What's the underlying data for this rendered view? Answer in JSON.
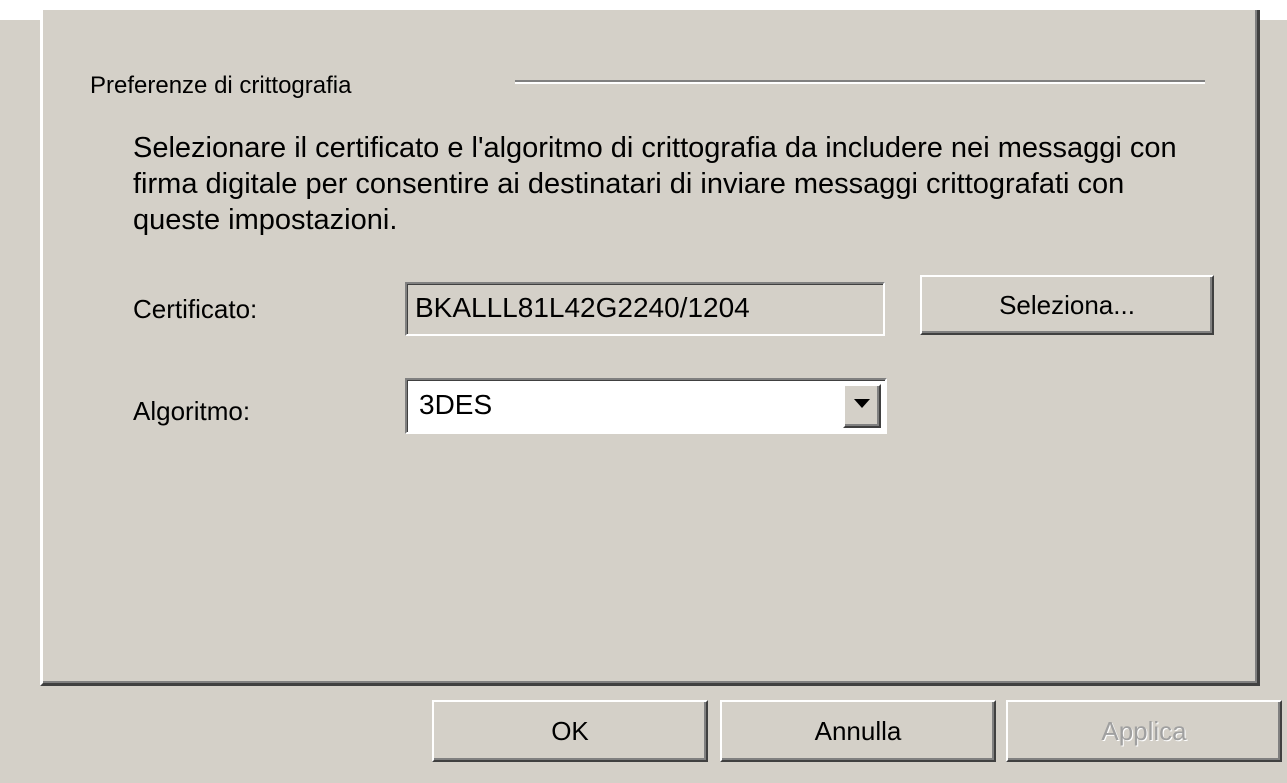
{
  "group": {
    "title": "Preferenze di crittografia",
    "description": "Selezionare il certificato e l'algoritmo di crittografia da includere nei messaggi con firma digitale per consentire ai destinatari di inviare messaggi crittografati con queste impostazioni."
  },
  "certificate": {
    "label": "Certificato:",
    "value": "BKALLL81L42G2240/1204",
    "select_button": "Seleziona..."
  },
  "algorithm": {
    "label": "Algoritmo:",
    "selected": "3DES",
    "dropdown_icon": "chevron-down-icon"
  },
  "buttons": {
    "ok": "OK",
    "cancel": "Annulla",
    "apply": "Applica"
  },
  "colors": {
    "dialog_face": "#d4d0c8",
    "disabled_text": "#a0a0a0"
  }
}
